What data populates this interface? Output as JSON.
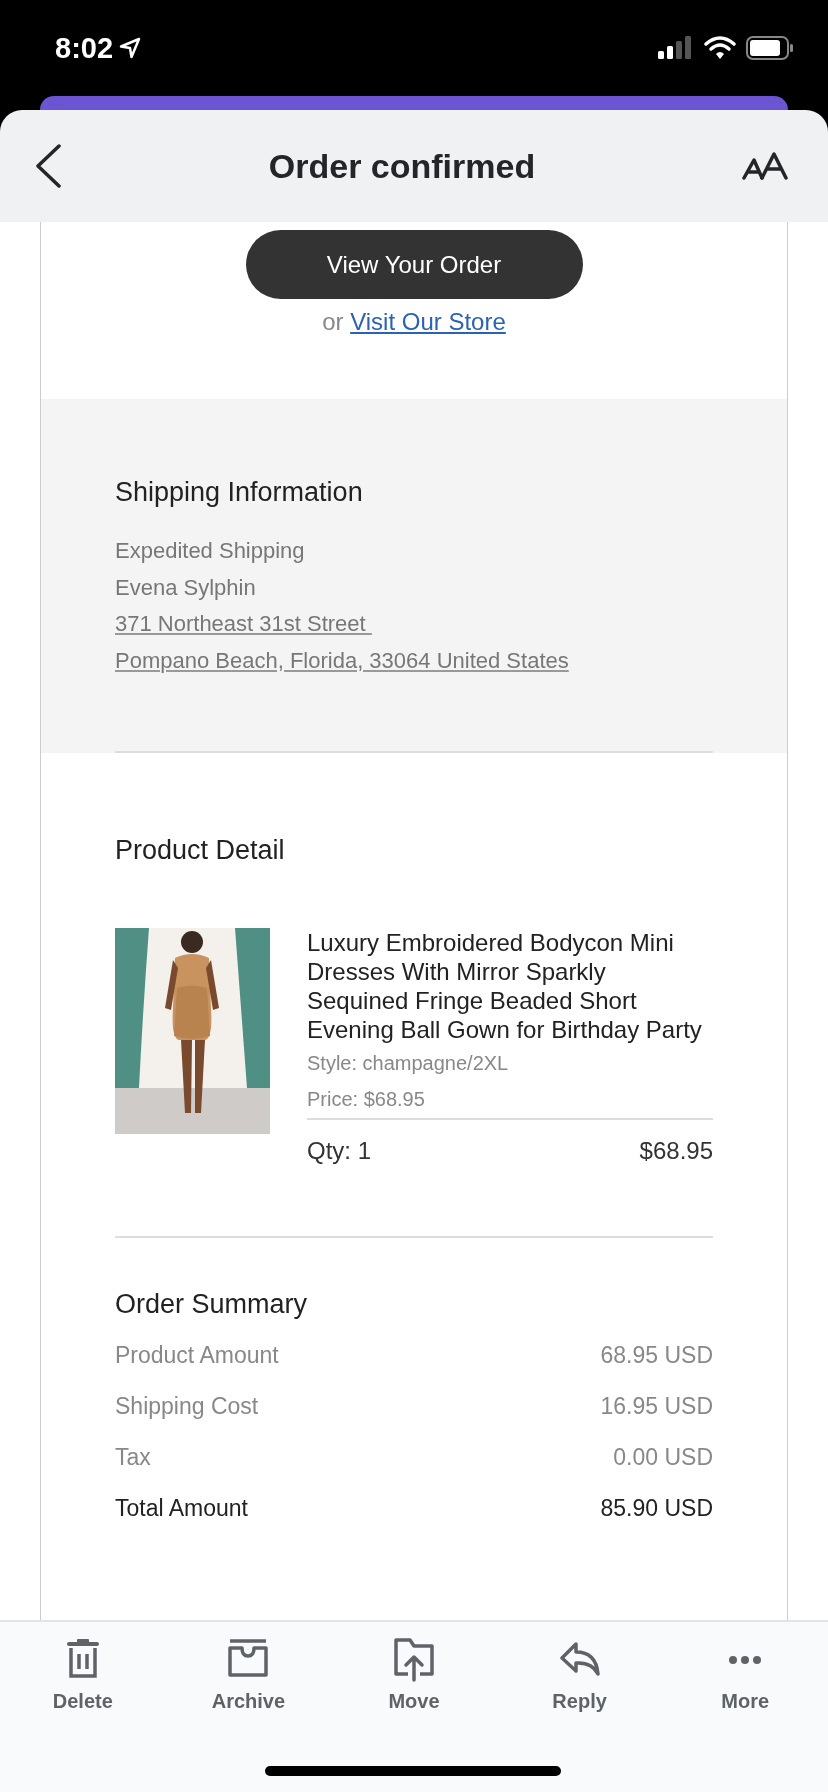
{
  "status_bar": {
    "time": "8:02"
  },
  "header": {
    "title": "Order confirmed"
  },
  "email": {
    "primary_button": "View Your Order",
    "alt_prefix": "or",
    "alt_link": "Visit Our Store",
    "shipping": {
      "heading": "Shipping Information",
      "lines": [
        {
          "text": "Expedited Shipping",
          "underlined": false
        },
        {
          "text": "Evena Sylphin",
          "underlined": false
        },
        {
          "text": "371 Northeast 31st Street ",
          "underlined": true
        },
        {
          "text": "Pompano Beach, Florida, 33064 United States",
          "underlined": true
        }
      ]
    },
    "product_detail": {
      "heading": "Product Detail",
      "name": "Luxury Embroidered Bodycon Mini Dresses With Mirror Sparkly Sequined Fringe Beaded Short Evening Ball Gown for Birthday Party",
      "style": "Style: champagne/2XL",
      "price": "Price: $68.95",
      "qty": "Qty: 1",
      "total": "$68.95"
    },
    "summary": {
      "heading": "Order Summary",
      "rows": [
        {
          "label": "Product Amount",
          "value": "68.95 USD",
          "emphasis": false
        },
        {
          "label": "Shipping Cost",
          "value": "16.95 USD",
          "emphasis": false
        },
        {
          "label": "Tax",
          "value": "0.00 USD",
          "emphasis": false
        },
        {
          "label": "Total Amount",
          "value": "85.90 USD",
          "emphasis": true
        }
      ]
    }
  },
  "toolbar": [
    {
      "label": "Delete",
      "kind": "trash"
    },
    {
      "label": "Archive",
      "kind": "archive"
    },
    {
      "label": "Move",
      "kind": "move"
    },
    {
      "label": "Reply",
      "kind": "reply"
    },
    {
      "label": "More",
      "kind": "more"
    }
  ]
}
